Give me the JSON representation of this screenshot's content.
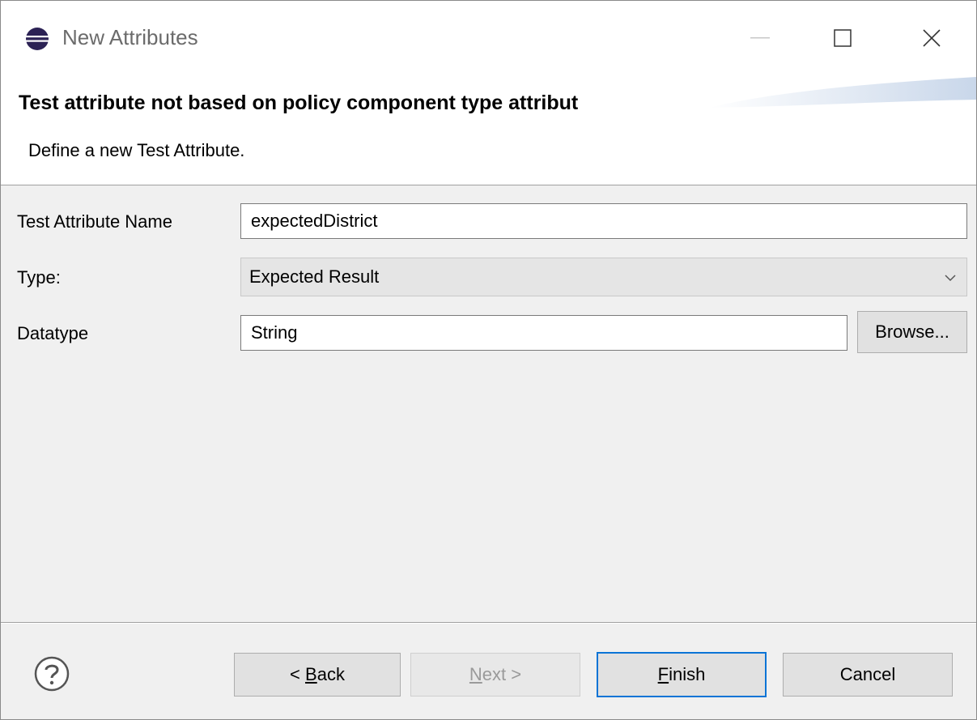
{
  "window": {
    "title": "New Attributes",
    "app_icon": "eclipse-icon",
    "controls": [
      "minimize-icon",
      "maximize-icon",
      "close-icon"
    ]
  },
  "banner": {
    "title": "Test attribute not based on policy component type attribut",
    "description": "Define a new Test Attribute."
  },
  "form": {
    "name_label": "Test Attribute Name",
    "name_value": "expectedDistrict",
    "type_label": "Type:",
    "type_value": "Expected Result",
    "datatype_label": "Datatype",
    "datatype_value": "String",
    "browse_label": "Browse..."
  },
  "footer": {
    "help_icon": "help-icon",
    "back_prefix": "< ",
    "back_mnemonic": "B",
    "back_rest": "ack",
    "next_mnemonic": "N",
    "next_rest": "ext >",
    "finish_mnemonic": "F",
    "finish_rest": "inish",
    "cancel_label": "Cancel"
  },
  "colors": {
    "default_button_border": "#0a74d6",
    "disabled_text": "#9a9a9a",
    "dialog_bg": "#f0f0f0"
  }
}
